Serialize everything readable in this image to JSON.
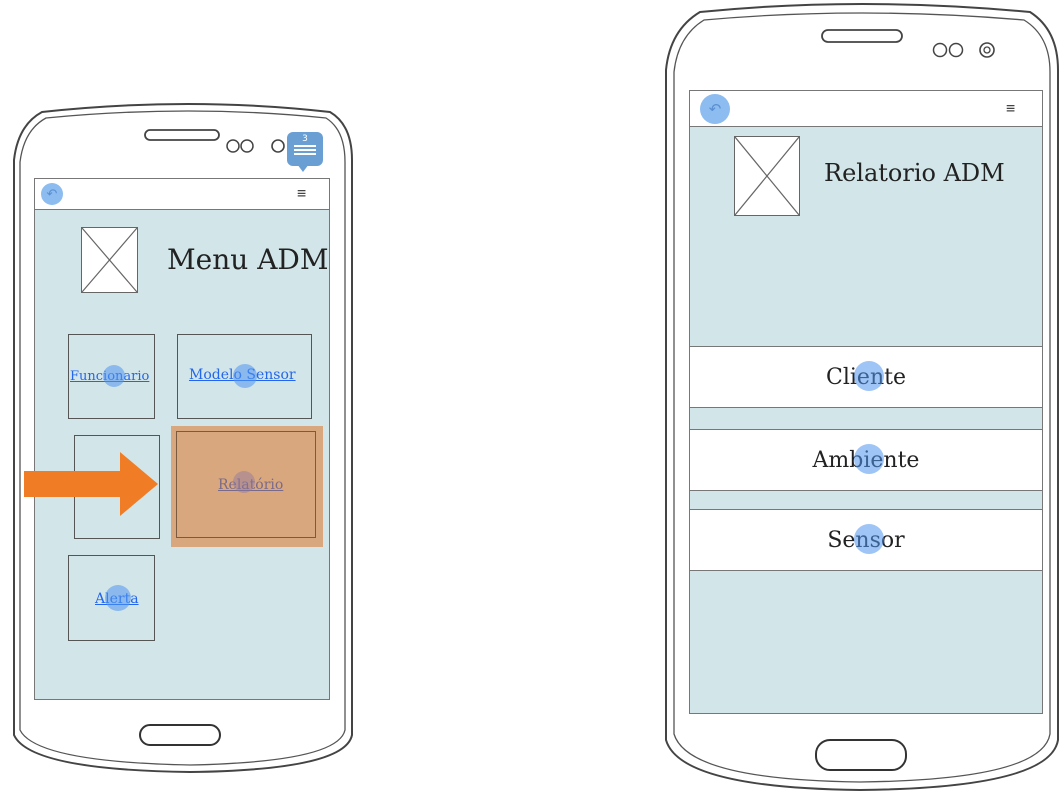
{
  "left_phone": {
    "notification_count": "3",
    "title": "Menu ADM",
    "tiles": [
      {
        "label": "Funcionario"
      },
      {
        "label": "Modelo Sensor"
      },
      {
        "label": "Relatório"
      },
      {
        "label": "Alerta"
      }
    ]
  },
  "right_phone": {
    "title": "Relatorio ADM",
    "buttons": [
      {
        "label": "Cliente"
      },
      {
        "label": "Ambiente"
      },
      {
        "label": "Sensor"
      }
    ]
  },
  "colors": {
    "screen_bg": "#d2e5e8",
    "link": "#2266ee",
    "highlight": "#d9a77e",
    "arrow": "#f07d26",
    "hotspot": "#5096f0"
  },
  "icons": [
    "back-arrow-icon",
    "settings-sliders-icon",
    "image-placeholder-icon",
    "notification-bubble-icon",
    "arrow-right-icon"
  ]
}
